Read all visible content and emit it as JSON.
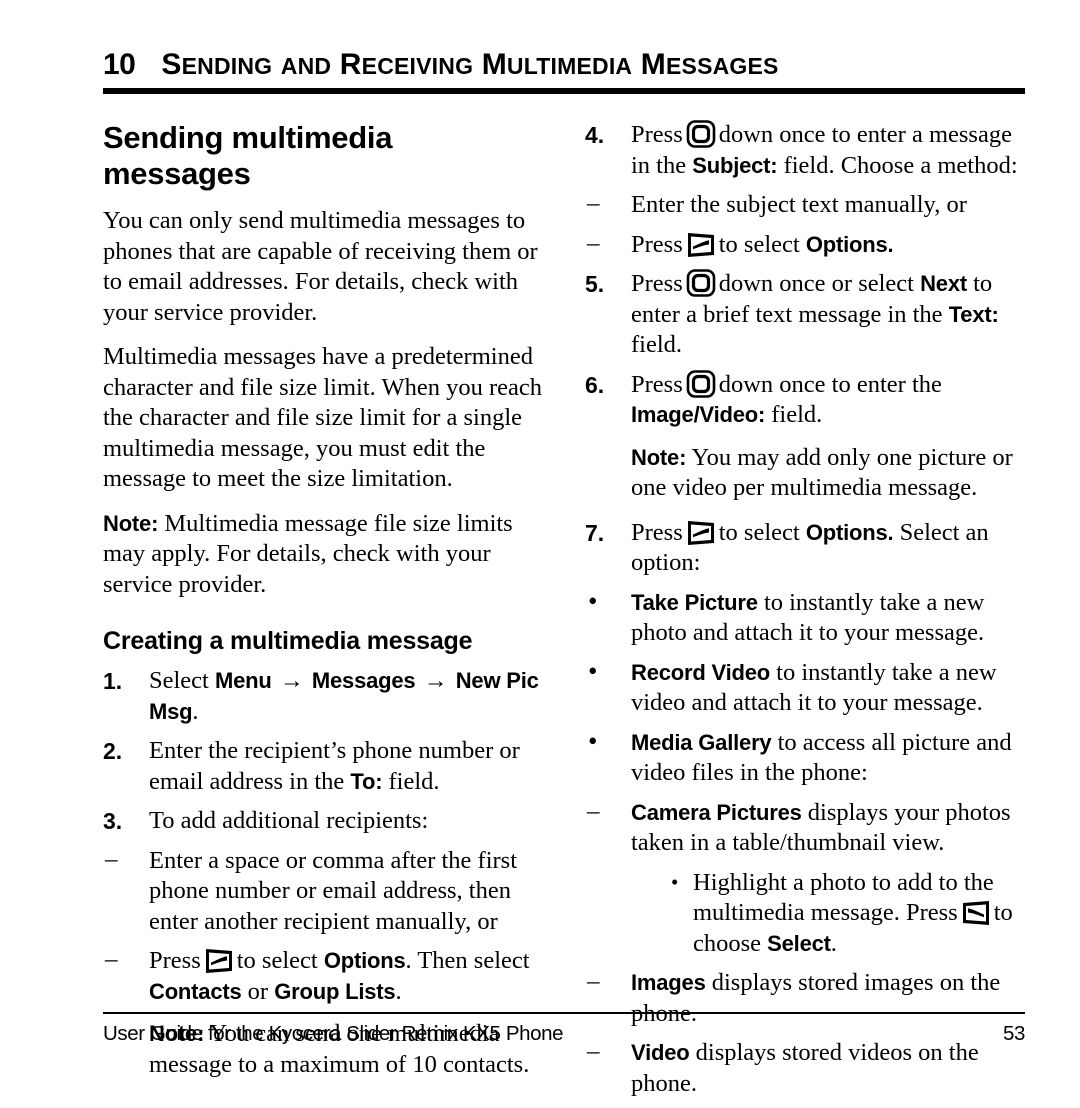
{
  "header": {
    "chapter_number": "10",
    "chapter_title": "Sending and Receiving Multimedia Messages"
  },
  "left_column": {
    "heading": "Sending multimedia messages",
    "para1": "You can only send multimedia messages to phones that are capable of receiving them or to email addresses. For details, check with your service provider.",
    "para2": "Multimedia messages have a predetermined character and file size limit. When you reach the character and file size limit for a single multimedia message, you must edit the message to meet the size limitation.",
    "note1_label": "Note:",
    "note1_text": "Multimedia message file size limits may apply. For details, check with your service provider.",
    "subheading": "Creating a multimedia message",
    "step1": {
      "marker": "1.",
      "lead": "Select",
      "menu1": "Menu",
      "arrow": "→",
      "menu2": "Messages",
      "menu3": "New Pic Msg",
      "end": "."
    },
    "step2": {
      "marker": "2.",
      "text_before": "Enter the recipient’s phone number or email address in the",
      "field": "To:",
      "text_after": "field."
    },
    "step3": {
      "marker": "3.",
      "text": "To add additional recipients:"
    },
    "dash1": {
      "marker": "–",
      "text": "Enter a space or comma after the first phone number or email address, then enter another recipient manually, or"
    },
    "dash2": {
      "marker": "–",
      "press": "Press",
      "icon": "left-softkey-icon",
      "to_select": "to select",
      "options": "Options",
      "then_select": ". Then select",
      "contacts": "Contacts",
      "or": "or",
      "group_lists": "Group Lists",
      "end": "."
    },
    "note2_label": "Note:",
    "note2_text": "You can send one multimedia message to a maximum of 10 contacts."
  },
  "right_column": {
    "step4": {
      "marker": "4.",
      "press": "Press",
      "icon": "navigation-key-icon",
      "mid": "down once to enter a message in the",
      "field": "Subject:",
      "end": "field. Choose a method:"
    },
    "step4_dash1": {
      "marker": "–",
      "text": "Enter the subject text manually, or"
    },
    "step4_dash2": {
      "marker": "–",
      "press": "Press",
      "icon": "left-softkey-icon",
      "to_select": "to select",
      "options": "Options.",
      "end": ""
    },
    "step5": {
      "marker": "5.",
      "press": "Press",
      "icon": "navigation-key-icon",
      "mid": "down once or select",
      "next": "Next",
      "mid2": "to enter a brief text message in the",
      "field": "Text:",
      "end": "field."
    },
    "step6": {
      "marker": "6.",
      "press": "Press",
      "icon": "navigation-key-icon",
      "mid": "down once to enter the",
      "field": "Image/Video:",
      "end": "field."
    },
    "note3_label": "Note:",
    "note3_text": "You may add only one picture or one video per multimedia message.",
    "step7": {
      "marker": "7.",
      "press": "Press",
      "icon": "left-softkey-icon",
      "to_select": "to select",
      "options": "Options.",
      "end": "Select an option:"
    },
    "bullet1": {
      "marker": "•",
      "term": "Take Picture",
      "text": "to instantly take a new photo and attach it to your message."
    },
    "bullet2": {
      "marker": "•",
      "term": "Record Video",
      "text": "to instantly take a new video and attach it to your message."
    },
    "bullet3": {
      "marker": "•",
      "term": "Media Gallery",
      "text": "to access all picture and video files in the phone:"
    },
    "sub_dash1": {
      "marker": "–",
      "term": "Camera Pictures",
      "text": "displays your photos taken in a table/thumbnail view."
    },
    "sub_dot1": {
      "marker": "•",
      "text_before": "Highlight a photo to add to the multimedia message. Press",
      "icon": "right-softkey-icon",
      "text_mid": "to choose",
      "term": "Select",
      "end": "."
    },
    "sub_dash2": {
      "marker": "–",
      "term": "Images",
      "text": "displays stored images on the phone."
    },
    "sub_dash3": {
      "marker": "–",
      "term": "Video",
      "text": "displays stored videos on the phone."
    }
  },
  "footer": {
    "text": "User Guide for the Kyocera Slider Remix KX5 Phone",
    "page_number": "53"
  }
}
